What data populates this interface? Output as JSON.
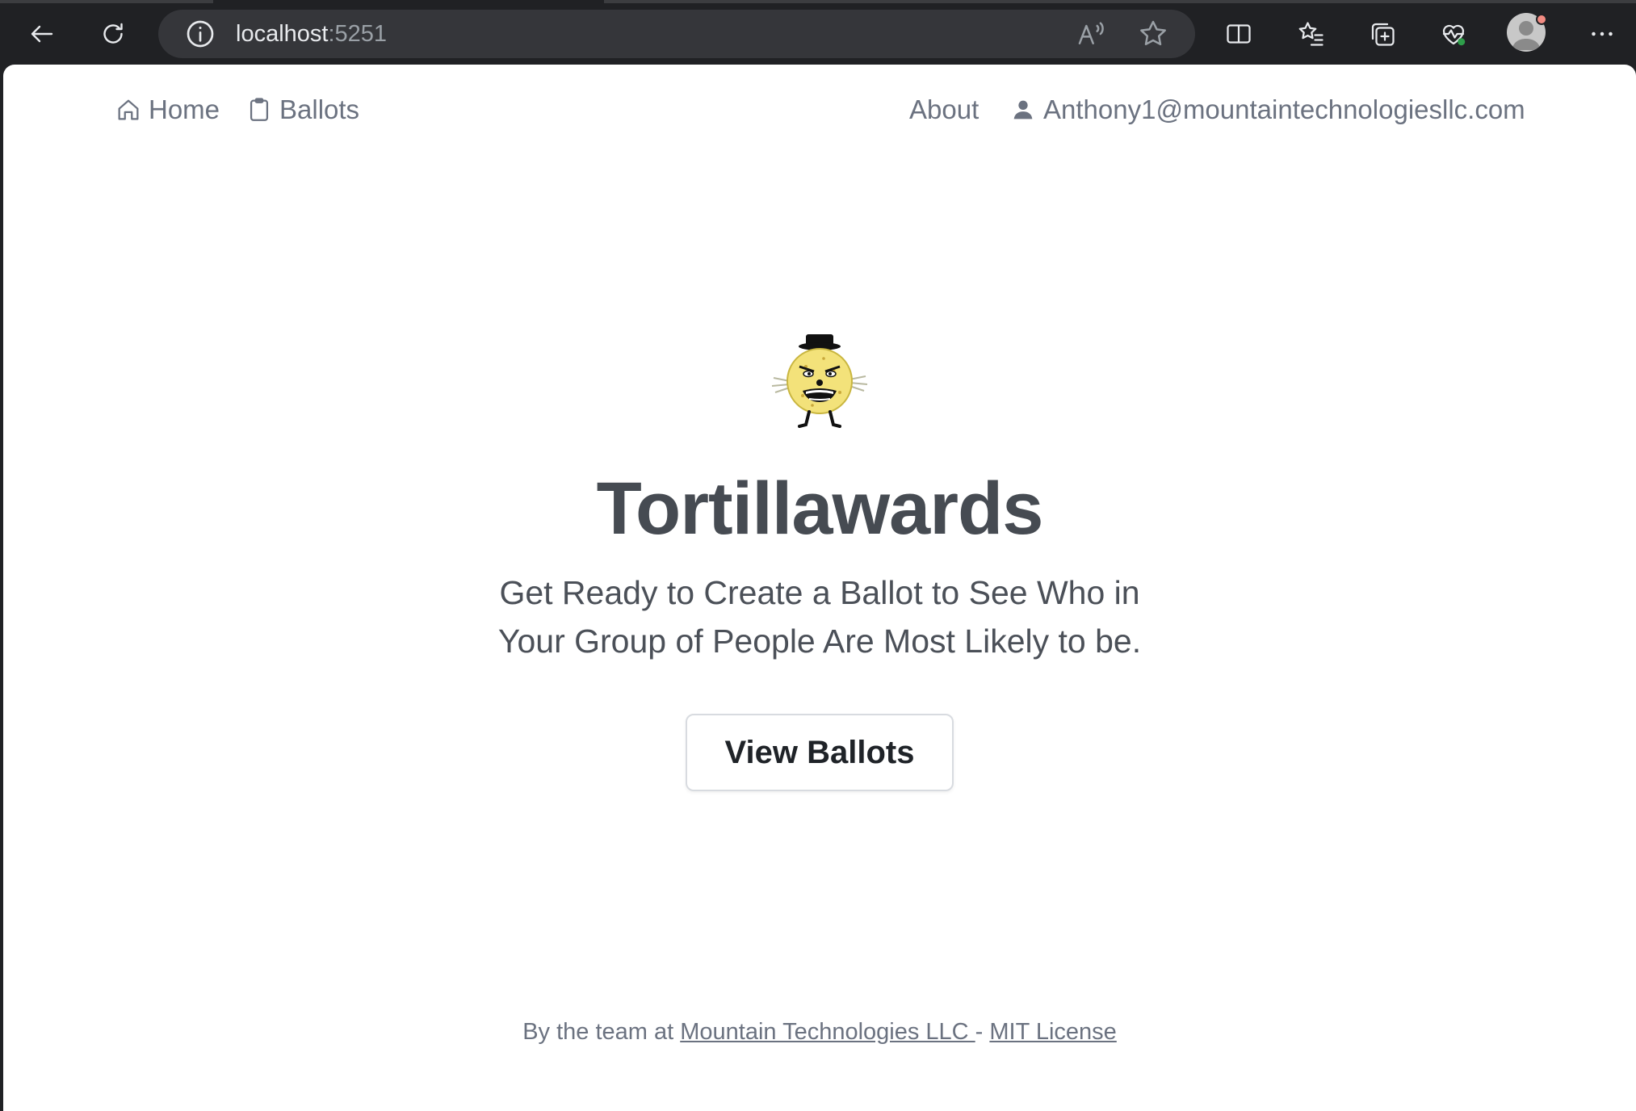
{
  "browser": {
    "url_host": "localhost",
    "url_port": ":5251",
    "icons": {
      "back": "back-arrow-icon",
      "reload": "reload-icon",
      "info": "info-icon",
      "read_aloud": "read-aloud-icon",
      "favorite": "star-icon",
      "split_screen": "split-screen-icon",
      "favorites": "favorites-list-icon",
      "collections": "collections-icon",
      "health": "browser-essentials-icon",
      "profile": "profile-avatar",
      "more": "more-options-icon"
    }
  },
  "nav": {
    "home_label": "Home",
    "ballots_label": "Ballots",
    "about_label": "About",
    "user_label": "Anthony1@mountaintechnologiesllc.com"
  },
  "hero": {
    "title": "Tortillawards",
    "subtitle": "Get Ready to Create a Ballot to See Who in Your Group of People Are Most Likely to be.",
    "cta_label": "View Ballots"
  },
  "footer": {
    "prefix": "By the team at ",
    "company_link": "Mountain Technologies LLC ",
    "separator": "- ",
    "license_link": "MIT License"
  },
  "colors": {
    "chrome_bg": "#202124",
    "omnibox_bg": "#35363a",
    "title": "#464b52",
    "muted_text": "#6b7280",
    "mascot_yellow": "#f3e27a"
  }
}
